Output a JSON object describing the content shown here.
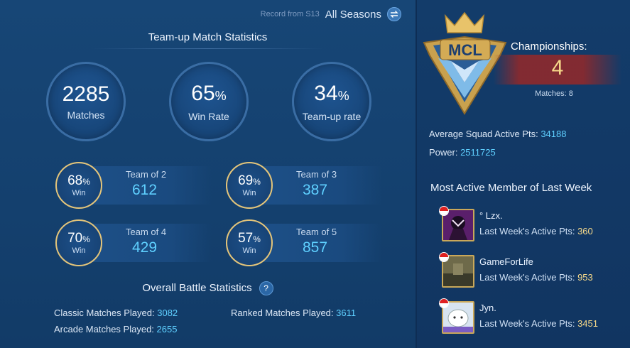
{
  "header": {
    "record_label": "Record from S13",
    "season_label": "All Seasons",
    "swap_icon": "swap-arrows-icon"
  },
  "team_up": {
    "title": "Team-up Match Statistics",
    "matches": {
      "value": "2285",
      "label": "Matches"
    },
    "win_rate": {
      "value": "65",
      "unit": "%",
      "label": "Win Rate"
    },
    "team_up_rate": {
      "value": "34",
      "unit": "%",
      "label": "Team-up rate"
    },
    "teams": [
      {
        "win_pct": "68",
        "unit": "%",
        "win_label": "Win",
        "label": "Team of 2",
        "count": "612"
      },
      {
        "win_pct": "69",
        "unit": "%",
        "win_label": "Win",
        "label": "Team of 3",
        "count": "387"
      },
      {
        "win_pct": "70",
        "unit": "%",
        "win_label": "Win",
        "label": "Team of 4",
        "count": "429"
      },
      {
        "win_pct": "57",
        "unit": "%",
        "win_label": "Win",
        "label": "Team of 5",
        "count": "857"
      }
    ]
  },
  "overall": {
    "title": "Overall Battle Statistics",
    "help_icon": "question-mark-icon",
    "classic_label": "Classic Matches Played: ",
    "classic_value": "3082",
    "ranked_label": "Ranked Matches Played: ",
    "ranked_value": "3611",
    "arcade_label": "Arcade Matches Played: ",
    "arcade_value": "2655"
  },
  "squad": {
    "emblem_text": "MCL",
    "championships_label": "Championships:",
    "championships_value": "4",
    "matches_label": "Matches: 8",
    "avg_active_label": "Average Squad Active Pts: ",
    "avg_active_value": "34188",
    "power_label": "Power: ",
    "power_value": "2511725"
  },
  "members": {
    "title": "Most Active Member of Last Week",
    "pts_label": "Last Week's Active Pts: ",
    "list": [
      {
        "name": "° Lzx.",
        "pts": "360"
      },
      {
        "name": "GameForLife",
        "pts": "953"
      },
      {
        "name": "Jyn.",
        "pts": "3451"
      }
    ]
  },
  "colors": {
    "accent_blue": "#5fd0ff",
    "gold": "#f6d98a",
    "ring_gold": "#e4c57a",
    "background": "#14406e"
  }
}
